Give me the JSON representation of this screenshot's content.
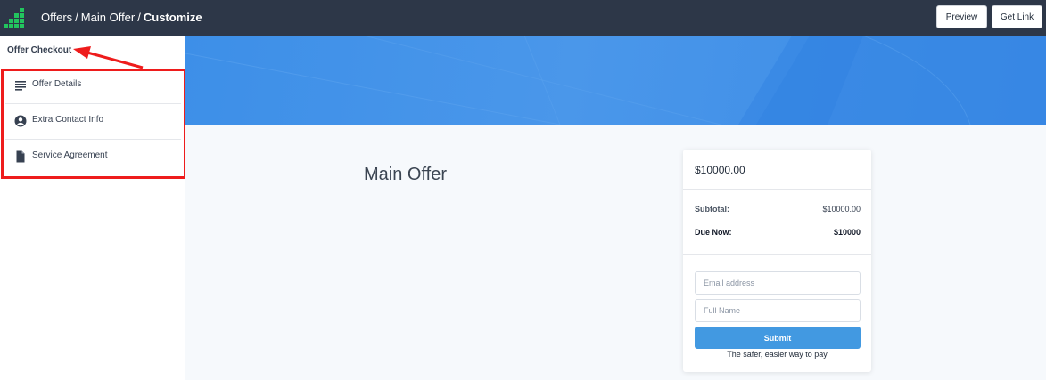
{
  "header": {
    "logo_icon": "bar-chart-logo-icon",
    "breadcrumb": [
      "Offers",
      "Main Offer",
      "Customize"
    ],
    "separator": "/",
    "preview_label": "Preview",
    "get_link_label": "Get Link"
  },
  "sidebar": {
    "title": "Offer Checkout",
    "items": [
      {
        "label": "Offer Details",
        "icon": "text-lines-icon"
      },
      {
        "label": "Extra Contact Info",
        "icon": "user-circle-icon"
      },
      {
        "label": "Service Agreement",
        "icon": "document-icon"
      }
    ]
  },
  "main": {
    "offer_title": "Main Offer"
  },
  "checkout": {
    "price": "$10000.00",
    "subtotal_label": "Subtotal:",
    "subtotal_value": "$10000.00",
    "due_label": "Due Now:",
    "due_value": "$10000",
    "email_placeholder": "Email address",
    "name_placeholder": "Full Name",
    "submit_label": "Submit",
    "tagline": "The safer, easier way to pay"
  },
  "colors": {
    "topbar": "#2d3748",
    "accent": "#4299e1",
    "logo": "#22c55e",
    "annotation": "#ee1c1c"
  }
}
